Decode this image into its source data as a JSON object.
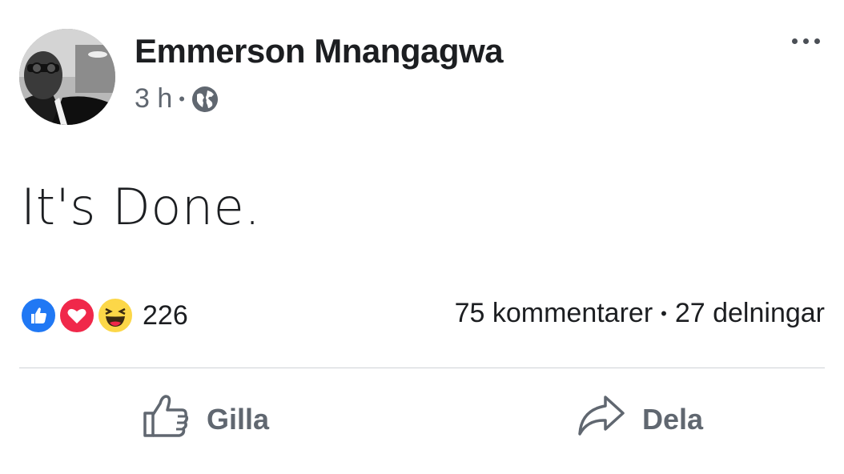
{
  "post": {
    "author": "Emmerson Mnangagwa",
    "time": "3 h",
    "separator": "•",
    "text": "It's Done."
  },
  "reactions": {
    "count": "226",
    "types": [
      "like-icon",
      "love-icon",
      "haha-icon"
    ],
    "colors": {
      "like": "#2078f4",
      "love": "#f0284a",
      "haha": "#fcd748"
    }
  },
  "stats": {
    "comments": "75 kommentarer",
    "separator": "•",
    "shares": "27 delningar"
  },
  "actions": {
    "like_label": "Gilla",
    "share_label": "Dela"
  }
}
